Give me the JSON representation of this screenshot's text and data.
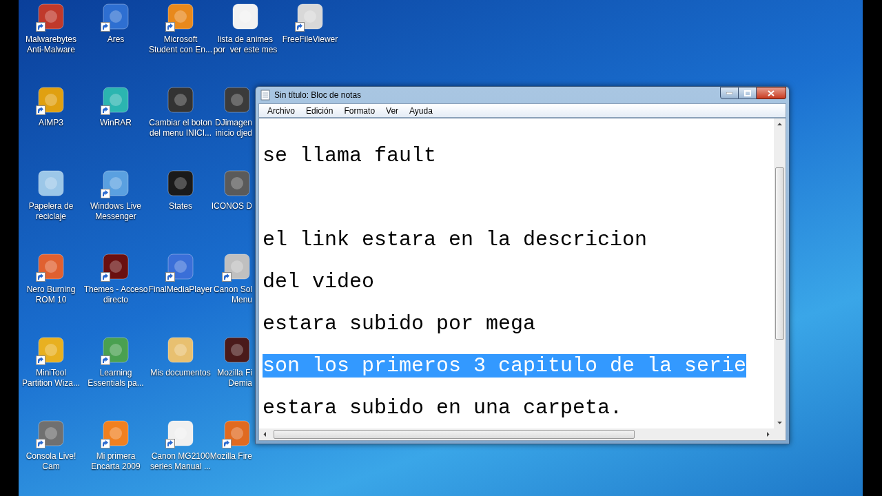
{
  "desktop": {
    "rows": [
      {
        "icons": [
          {
            "lines": [
              "Malwarebytes",
              "Anti-Malware"
            ],
            "shortcut": true,
            "partial": false
          },
          {
            "lines": [
              "Ares"
            ],
            "shortcut": true,
            "partial": false
          },
          {
            "lines": [
              "Microsoft",
              "Student con En..."
            ],
            "shortcut": true,
            "partial": false
          },
          {
            "lines": [
              "lista de animes",
              "por  ver este mes"
            ],
            "shortcut": false,
            "partial": false
          },
          {
            "lines": [
              "FreeFileViewer"
            ],
            "shortcut": true,
            "partial": false
          }
        ]
      },
      {
        "icons": [
          {
            "lines": [
              "AIMP3"
            ],
            "shortcut": true,
            "partial": false
          },
          {
            "lines": [
              "WinRAR"
            ],
            "shortcut": true,
            "partial": false
          },
          {
            "lines": [
              "Cambiar el boton",
              "del menu INICI..."
            ],
            "shortcut": false,
            "partial": false
          },
          {
            "lines": [
              "DJimagen",
              "inicio djed"
            ],
            "shortcut": false,
            "partial": true
          }
        ]
      },
      {
        "icons": [
          {
            "lines": [
              "Papelera de",
              "reciclaje"
            ],
            "shortcut": false,
            "partial": false
          },
          {
            "lines": [
              "Windows Live",
              "Messenger"
            ],
            "shortcut": true,
            "partial": false
          },
          {
            "lines": [
              "States"
            ],
            "shortcut": false,
            "partial": false
          },
          {
            "lines": [
              "ICONOS D"
            ],
            "shortcut": false,
            "partial": true
          }
        ]
      },
      {
        "icons": [
          {
            "lines": [
              "Nero Burning",
              "ROM 10"
            ],
            "shortcut": true,
            "partial": false
          },
          {
            "lines": [
              "Themes - Acceso",
              "directo"
            ],
            "shortcut": true,
            "partial": false
          },
          {
            "lines": [
              "FinalMediaPlayer"
            ],
            "shortcut": true,
            "partial": false
          },
          {
            "lines": [
              "Canon Sol",
              "Menu"
            ],
            "shortcut": true,
            "partial": true
          }
        ]
      },
      {
        "icons": [
          {
            "lines": [
              "MiniTool",
              "Partition Wiza..."
            ],
            "shortcut": true,
            "partial": false
          },
          {
            "lines": [
              "Learning",
              "Essentials pa..."
            ],
            "shortcut": true,
            "partial": false
          },
          {
            "lines": [
              "Mis documentos"
            ],
            "shortcut": false,
            "partial": false
          },
          {
            "lines": [
              "Mozilla Fi",
              "Demia"
            ],
            "shortcut": false,
            "partial": true
          }
        ]
      },
      {
        "icons": [
          {
            "lines": [
              "Consola Live!",
              "Cam"
            ],
            "shortcut": true,
            "partial": false
          },
          {
            "lines": [
              "Mi primera",
              "Encarta 2009"
            ],
            "shortcut": true,
            "partial": false
          },
          {
            "lines": [
              "Canon MG2100",
              "series Manual ..."
            ],
            "shortcut": true,
            "partial": false
          },
          {
            "lines": [
              "Mozilla Fire"
            ],
            "shortcut": true,
            "partial": true
          }
        ]
      }
    ]
  },
  "notepad": {
    "title": "Sin título: Bloc de notas",
    "menu": [
      "Archivo",
      "Edición",
      "Formato",
      "Ver",
      "Ayuda"
    ],
    "lines": [
      {
        "text": "se llama fault",
        "selected": false
      },
      {
        "blank": true
      },
      {
        "text": "el link estara en la descricion",
        "selected": false
      },
      {
        "text": "del video",
        "selected": false
      },
      {
        "text": "estara subido por mega",
        "selected": false
      },
      {
        "text": "son los primeros 3 capitulo de la serie",
        "selected": true
      },
      {
        "text": "estara subido en una carpeta.",
        "selected": false
      }
    ]
  }
}
